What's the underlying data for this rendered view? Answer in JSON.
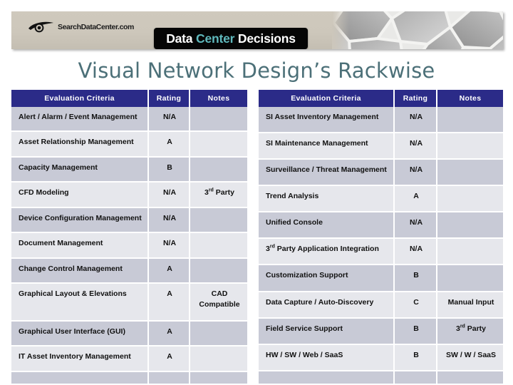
{
  "banner": {
    "logo_text": "SearchDataCenter.com",
    "logo_icon": "eye-icon",
    "brand_word1": "Data",
    "brand_word2": "Center",
    "brand_word3": "Decisions",
    "brand_accent_color": "#5fb9bd",
    "background_color": "#cdc7bb",
    "pattern": "hexagon-honeycomb"
  },
  "title": {
    "text": "Visual Network Design’s Rackwise",
    "color": "#4c7078"
  },
  "tables": {
    "headers": [
      "Evaluation  Criteria",
      "Rating",
      "Notes"
    ],
    "header_bg": "#2b2b88",
    "row_bg_a": "#c8cad6",
    "row_bg_b": "#e6e7ec",
    "left": [
      {
        "criteria": "Alert / Alarm / Event Management",
        "rating": "N/A",
        "notes": ""
      },
      {
        "criteria": "Asset Relationship Management",
        "rating": "A",
        "notes": ""
      },
      {
        "criteria": "Capacity Management",
        "rating": "B",
        "notes": ""
      },
      {
        "criteria": "CFD Modeling",
        "rating": "N/A",
        "notes": "3rd Party",
        "notes_sup": "rd",
        "notes_pre": "3",
        "notes_post": " Party"
      },
      {
        "criteria": "Device Configuration Management",
        "rating": "N/A",
        "notes": ""
      },
      {
        "criteria": "Document Management",
        "rating": "N/A",
        "notes": ""
      },
      {
        "criteria": "Change Control Management",
        "rating": "A",
        "notes": ""
      },
      {
        "criteria": "Graphical Layout & Elevations",
        "rating": "A",
        "notes": "CAD Compatible"
      },
      {
        "criteria": "Graphical User Interface (GUI)",
        "rating": "A",
        "notes": ""
      },
      {
        "criteria": "IT Asset Inventory Management",
        "rating": "A",
        "notes": ""
      },
      {
        "criteria": "",
        "rating": "",
        "notes": ""
      }
    ],
    "right": [
      {
        "criteria": "SI Asset Inventory Management",
        "rating": "N/A",
        "notes": ""
      },
      {
        "criteria": "SI Maintenance Management",
        "rating": "N/A",
        "notes": ""
      },
      {
        "criteria": "Surveillance / Threat Management",
        "rating": "N/A",
        "notes": ""
      },
      {
        "criteria": "Trend Analysis",
        "rating": "A",
        "notes": ""
      },
      {
        "criteria": "Unified Console",
        "rating": "N/A",
        "notes": ""
      },
      {
        "criteria": "3rd Party Application Integration",
        "rating": "N/A",
        "notes": "",
        "crit_pre": "3",
        "crit_sup": "rd",
        "crit_post": " Party Application Integration"
      },
      {
        "criteria": "Customization Support",
        "rating": "B",
        "notes": ""
      },
      {
        "criteria": "Data Capture / Auto-Discovery",
        "rating": "C",
        "notes": "Manual Input"
      },
      {
        "criteria": "Field Service Support",
        "rating": "B",
        "notes": "3rd Party",
        "notes_pre": "3",
        "notes_sup": "rd",
        "notes_post": " Party"
      },
      {
        "criteria": "HW / SW / Web / SaaS",
        "rating": "B",
        "notes": "SW / W / SaaS"
      },
      {
        "criteria": "",
        "rating": "",
        "notes": ""
      }
    ]
  }
}
